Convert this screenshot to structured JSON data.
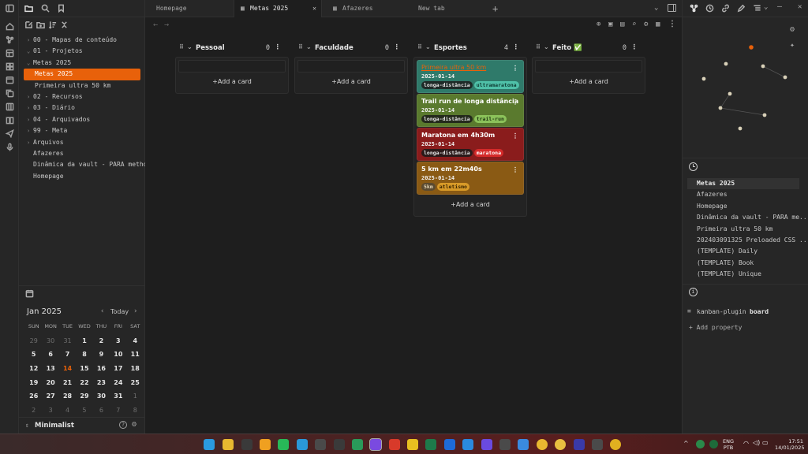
{
  "left_sidebar": {
    "tree": [
      {
        "label": "00 - Mapas de conteúdo",
        "indent": 0,
        "chev": "›"
      },
      {
        "label": "01 - Projetos",
        "indent": 0,
        "chev": "⌄"
      },
      {
        "label": "Metas 2025",
        "indent": 1,
        "chev": "⌄"
      },
      {
        "label": "Metas 2025",
        "indent": 2,
        "chev": "",
        "active": true
      },
      {
        "label": "Primeira ultra 50 km",
        "indent": 2,
        "chev": ""
      },
      {
        "label": "02 - Recursos",
        "indent": 0,
        "chev": "›"
      },
      {
        "label": "03 - Diário",
        "indent": 0,
        "chev": "›"
      },
      {
        "label": "04 - Arquivados",
        "indent": 0,
        "chev": "›"
      },
      {
        "label": "99 - Meta",
        "indent": 0,
        "chev": "›"
      },
      {
        "label": "Arquivos",
        "indent": 0,
        "chev": "›"
      },
      {
        "label": "Afazeres",
        "indent": 0,
        "chev": ""
      },
      {
        "label": "Dinâmica da vault - PARA metho...",
        "indent": 0,
        "chev": ""
      },
      {
        "label": "Homepage",
        "indent": 0,
        "chev": ""
      }
    ],
    "calendar": {
      "month": "Jan 2025",
      "today_label": "Today",
      "dow": [
        "SUN",
        "MON",
        "TUE",
        "WED",
        "THU",
        "FRI",
        "SAT"
      ],
      "weeks": [
        [
          "29",
          "30",
          "31",
          "1",
          "2",
          "3",
          "4"
        ],
        [
          "5",
          "6",
          "7",
          "8",
          "9",
          "10",
          "11"
        ],
        [
          "12",
          "13",
          "14",
          "15",
          "16",
          "17",
          "18"
        ],
        [
          "19",
          "20",
          "21",
          "22",
          "23",
          "24",
          "25"
        ],
        [
          "26",
          "27",
          "28",
          "29",
          "30",
          "31",
          "1"
        ],
        [
          "2",
          "3",
          "4",
          "5",
          "6",
          "7",
          "8"
        ]
      ],
      "today": "14"
    },
    "vault_name": "Minimalist"
  },
  "tabs": [
    {
      "label": "Homepage"
    },
    {
      "label": "Metas 2025",
      "active": true
    },
    {
      "label": "Afazeres"
    },
    {
      "label": "New tab"
    }
  ],
  "kanban": {
    "add_card": "+Add a card",
    "lanes": [
      {
        "name": "Pessoal",
        "count": "0",
        "cards": []
      },
      {
        "name": "Faculdade",
        "count": "0",
        "cards": []
      },
      {
        "name": "Esportes",
        "count": "4",
        "cards": [
          {
            "title": "Primeira ultra 50 km",
            "link": true,
            "date": "2025-01-14",
            "color": "#2f7a6a",
            "tags": [
              {
                "t": "longa-distância",
                "bg": "#1f2a28",
                "fg": "#e8e8e8"
              },
              {
                "t": "ultramaratona",
                "bg": "#4fc0a8",
                "fg": "#0e3a32"
              }
            ]
          },
          {
            "title": "Trail run de longa distância",
            "date": "2025-01-14",
            "color": "#5a7a2e",
            "tags": [
              {
                "t": "longa-distância",
                "bg": "#242a1c",
                "fg": "#e8e8e8"
              },
              {
                "t": "trail-run",
                "bg": "#8bc25a",
                "fg": "#1e3410"
              }
            ]
          },
          {
            "title": "Maratona em 4h30m",
            "date": "2025-01-14",
            "color": "#8a1c1c",
            "tags": [
              {
                "t": "longa-distância",
                "bg": "#2a1a1a",
                "fg": "#e8e8e8"
              },
              {
                "t": "maratona",
                "bg": "#d52a2a",
                "fg": "#ffffff"
              }
            ]
          },
          {
            "title": "5 km em 22m40s",
            "date": "2025-01-14",
            "color": "#8a5a14",
            "tags": [
              {
                "t": "5km",
                "bg": "#5a4a30",
                "fg": "#e8d8b8"
              },
              {
                "t": "atletismo",
                "bg": "#d89a28",
                "fg": "#3a2400"
              }
            ]
          }
        ]
      },
      {
        "name": "Feito ✅",
        "count": "0",
        "cards": []
      }
    ]
  },
  "right_sidebar": {
    "recent": [
      "Metas 2025",
      "Afazeres",
      "Homepage",
      "Dinâmica da vault - PARA me...",
      "Primeira ultra 50 km",
      "202403091325 Preloaded CSS ...",
      "(TEMPLATE) Daily",
      "(TEMPLATE) Book",
      "(TEMPLATE) Unique"
    ],
    "property_key": "kanban-plugin",
    "property_val": "board",
    "add_property": "+ Add property"
  },
  "taskbar": {
    "lang": "ENG",
    "layout": "PTB",
    "time": "17:51",
    "date": "14/01/2025"
  }
}
